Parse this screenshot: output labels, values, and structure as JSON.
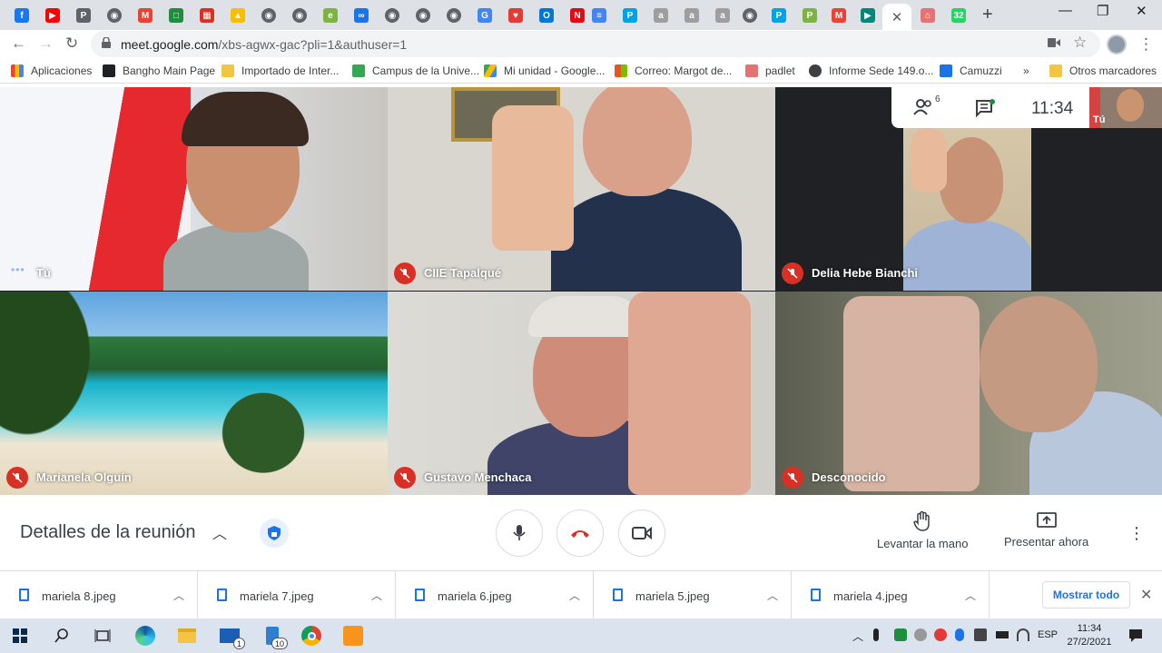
{
  "browser": {
    "tabs": [
      {
        "icon": "facebook-icon",
        "color": "#1877f2",
        "glyph": "f"
      },
      {
        "icon": "youtube-icon",
        "color": "#ff0000",
        "glyph": "▶"
      },
      {
        "icon": "pbx-icon",
        "color": "#5f6368",
        "glyph": "P"
      },
      {
        "icon": "globe-icon",
        "color": "#5f6368",
        "glyph": "◉"
      },
      {
        "icon": "gmail-icon",
        "color": "#ea4335",
        "glyph": "M"
      },
      {
        "icon": "classroom-icon",
        "color": "#1e8e3e",
        "glyph": "□"
      },
      {
        "icon": "calendar-icon",
        "color": "#d93025",
        "glyph": "▦"
      },
      {
        "icon": "drive-icon",
        "color": "#fbbc04",
        "glyph": "▲"
      },
      {
        "icon": "globe-icon",
        "color": "#5f6368",
        "glyph": "◉"
      },
      {
        "icon": "globe-icon",
        "color": "#5f6368",
        "glyph": "◉"
      },
      {
        "icon": "edmodo-icon",
        "color": "#7cb342",
        "glyph": "e"
      },
      {
        "icon": "link-icon",
        "color": "#1a73e8",
        "glyph": "∞"
      },
      {
        "icon": "globe-icon",
        "color": "#5f6368",
        "glyph": "◉"
      },
      {
        "icon": "globe-icon",
        "color": "#5f6368",
        "glyph": "◉"
      },
      {
        "icon": "globe-icon",
        "color": "#5f6368",
        "glyph": "◉"
      },
      {
        "icon": "google-icon",
        "color": "#4285f4",
        "glyph": "G"
      },
      {
        "icon": "heart-icon",
        "color": "#e53935",
        "glyph": "♥"
      },
      {
        "icon": "outlook-icon",
        "color": "#0078d4",
        "glyph": "O"
      },
      {
        "icon": "netflix-icon",
        "color": "#e50914",
        "glyph": "N"
      },
      {
        "icon": "docs-icon",
        "color": "#4285f4",
        "glyph": "≡"
      },
      {
        "icon": "padlet-icon",
        "color": "#00a2e8",
        "glyph": "P"
      },
      {
        "icon": "abc-icon",
        "color": "#9e9e9e",
        "glyph": "a"
      },
      {
        "icon": "abc-icon",
        "color": "#9e9e9e",
        "glyph": "a"
      },
      {
        "icon": "abc-icon",
        "color": "#9e9e9e",
        "glyph": "a"
      },
      {
        "icon": "globe-icon",
        "color": "#5f6368",
        "glyph": "◉"
      },
      {
        "icon": "padlet-icon",
        "color": "#00a2e8",
        "glyph": "P"
      },
      {
        "icon": "padlet-green-icon",
        "color": "#7cb342",
        "glyph": "P"
      },
      {
        "icon": "gmail-icon",
        "color": "#ea4335",
        "glyph": "M"
      },
      {
        "icon": "meet-icon",
        "color": "#00897b",
        "glyph": "▶"
      },
      {
        "icon": "close-icon",
        "color": "#5f6368",
        "glyph": "✕",
        "active": true
      },
      {
        "icon": "home-icon",
        "color": "#e57373",
        "glyph": "⌂"
      },
      {
        "icon": "whatsapp-icon",
        "color": "#25d366",
        "glyph": "32"
      }
    ],
    "url_host": "meet.google.com",
    "url_rest": "/xbs-agwx-gac?pli=1&authuser=1",
    "bookmarks": [
      {
        "label": "Aplicaciones",
        "color": "#ea4335"
      },
      {
        "label": "Bangho Main Page",
        "color": "#202124"
      },
      {
        "label": "Importado de Inter...",
        "color": "#f4c542"
      },
      {
        "label": "Campus de la Unive...",
        "color": "#34a853"
      },
      {
        "label": "Mi unidad - Google...",
        "color": "#fbbc04"
      },
      {
        "label": "Correo: Margot de...",
        "color": "#f25022"
      },
      {
        "label": "padlet",
        "color": "#e57373"
      },
      {
        "label": "Informe Sede 149.o...",
        "color": "#3c4043"
      },
      {
        "label": "Camuzzi",
        "color": "#1a73e8"
      }
    ],
    "more_bookmarks": "»",
    "other_bookmarks": "Otros marcadores"
  },
  "meet": {
    "time": "11:34",
    "people_count": "6",
    "self_thumb_label": "Tú",
    "participants": [
      {
        "name": "Tú",
        "muted": false
      },
      {
        "name": "CIIE Tapalqué",
        "muted": true
      },
      {
        "name": "Delia Hebe Bianchi",
        "muted": true
      },
      {
        "name": "Marianela Olguín",
        "muted": true
      },
      {
        "name": "Gustavo Menchaca",
        "muted": true
      },
      {
        "name": "Desconocido",
        "muted": true
      }
    ],
    "details_title": "Detalles de la reunión",
    "raise_hand": "Levantar la mano",
    "present_now": "Presentar ahora"
  },
  "downloads": {
    "files": [
      "mariela 8.jpeg",
      "mariela 7.jpeg",
      "mariela 6.jpeg",
      "mariela 5.jpeg",
      "mariela 4.jpeg"
    ],
    "show_all": "Mostrar todo"
  },
  "taskbar": {
    "mail_badge": "1",
    "files_badge": "10",
    "lang": "ESP",
    "time": "11:34",
    "date": "27/2/2021"
  }
}
